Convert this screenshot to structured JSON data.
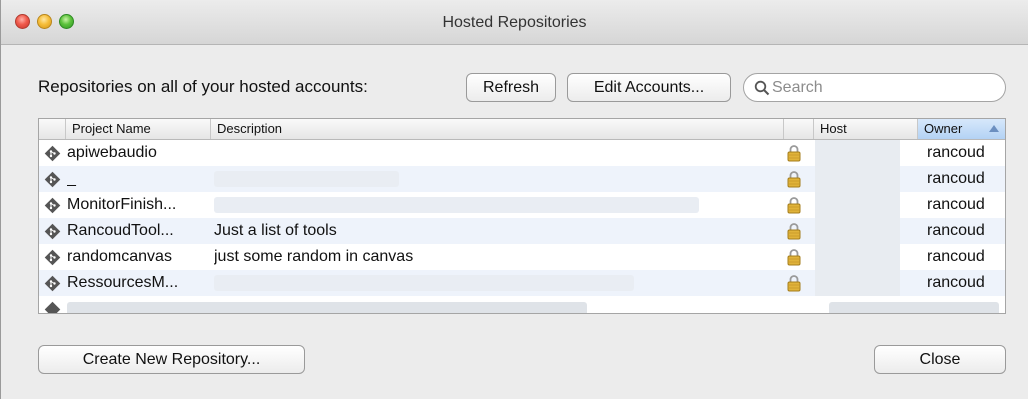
{
  "window": {
    "title": "Hosted Repositories"
  },
  "toolbar": {
    "label": "Repositories on all of your hosted accounts:",
    "refresh_label": "Refresh",
    "edit_accounts_label": "Edit Accounts...",
    "search_placeholder": "Search"
  },
  "table": {
    "columns": [
      "Project Name",
      "Description",
      "Host",
      "Owner"
    ],
    "sorted_column": "Owner",
    "rows": [
      {
        "project": "apiwebaudio",
        "description": "",
        "owner": "rancoud"
      },
      {
        "project": "_",
        "description": "",
        "owner": "rancoud"
      },
      {
        "project": "MonitorFinish...",
        "description": "",
        "owner": "rancoud"
      },
      {
        "project": "RancoudTool...",
        "description": "Just a list of tools",
        "owner": "rancoud"
      },
      {
        "project": "randomcanvas",
        "description": "just some random in canvas",
        "owner": "rancoud"
      },
      {
        "project": "RessourcesM...",
        "description": "",
        "owner": "rancoud"
      }
    ]
  },
  "footer": {
    "create_label": "Create New Repository...",
    "close_label": "Close"
  },
  "icons": {
    "row_icon": "git-icon",
    "lock_icon": "lock-icon",
    "search_icon": "search-icon"
  },
  "colors": {
    "sort_header": "#b3d2f4",
    "alt_row": "#eef3fb"
  }
}
